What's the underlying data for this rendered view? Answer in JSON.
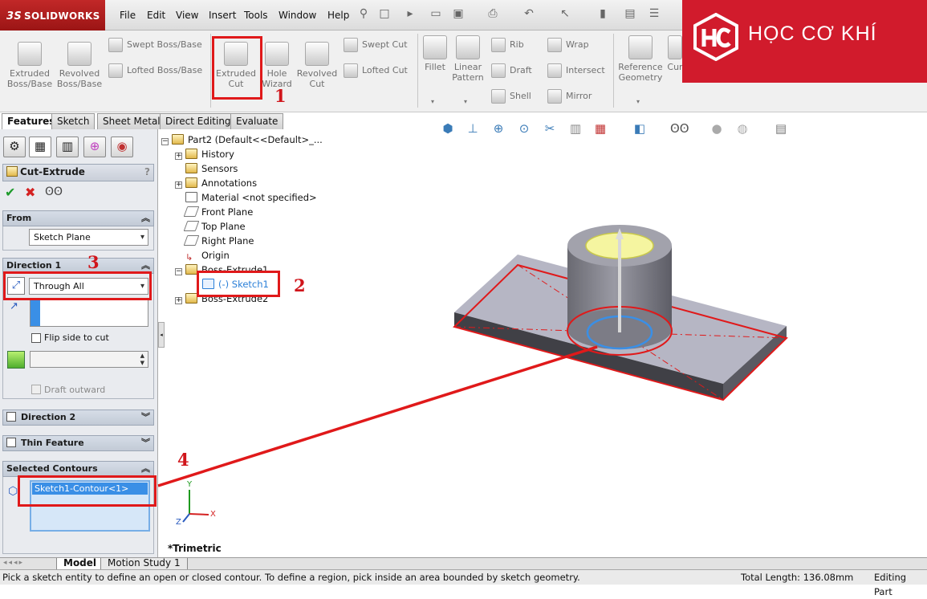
{
  "app": {
    "logo_text": "SOLIDWORKS",
    "logo_prefix": "3S"
  },
  "menu": [
    "File",
    "Edit",
    "View",
    "Insert",
    "Tools",
    "Window",
    "Help"
  ],
  "ribbon": {
    "extruded_boss": "Extruded\nBoss/Base",
    "revolved_boss": "Revolved\nBoss/Base",
    "swept_boss": "Swept Boss/Base",
    "lofted_boss": "Lofted Boss/Base",
    "extruded_cut": "Extruded\nCut",
    "hole_wizard": "Hole\nWizard",
    "revolved_cut": "Revolved\nCut",
    "swept_cut": "Swept Cut",
    "lofted_cut": "Lofted Cut",
    "fillet": "Fillet",
    "linear_pattern": "Linear\nPattern",
    "rib": "Rib",
    "draft": "Draft",
    "shell": "Shell",
    "wrap": "Wrap",
    "intersect": "Intersect",
    "mirror": "Mirror",
    "reference_geometry": "Reference\nGeometry",
    "curves": "Cur"
  },
  "brand": {
    "text": "HỌC CƠ KHÍ",
    "logo_letters": "HC",
    "color": "#d11b2c"
  },
  "tabs": [
    "Features",
    "Sketch",
    "Sheet Metal",
    "Direct Editing",
    "Evaluate"
  ],
  "property_manager": {
    "title": "Cut-Extrude",
    "help": "?",
    "from": {
      "header": "From",
      "value": "Sketch Plane"
    },
    "direction1": {
      "header": "Direction 1",
      "end_condition": "Through All",
      "flip_label": "Flip side to cut",
      "draft_label": "Draft outward"
    },
    "direction2": {
      "header": "Direction 2"
    },
    "thin_feature": {
      "header": "Thin Feature"
    },
    "selected_contours": {
      "header": "Selected Contours",
      "items": [
        "Sketch1-Contour<1>"
      ]
    }
  },
  "tree": {
    "root": "Part2  (Default<<Default>_...",
    "items": [
      "History",
      "Sensors",
      "Annotations",
      "Material <not specified>",
      "Front Plane",
      "Top Plane",
      "Right Plane",
      "Origin",
      "Boss-Extrude1",
      "(-) Sketch1",
      "Boss-Extrude2"
    ]
  },
  "viewport": {
    "view_label": "*Trimetric",
    "triad": {
      "x": "X",
      "y": "Y",
      "z": "Z"
    }
  },
  "annotations": {
    "n1": "1",
    "n2": "2",
    "n3": "3",
    "n4": "4",
    "color": "#e0191a"
  },
  "bottom_tabs": [
    "Model",
    "Motion Study 1"
  ],
  "status": {
    "message": "Pick a sketch entity to define an open or closed contour. To define a region, pick inside an area bounded by sketch geometry.",
    "total_length": "Total Length: 136.08mm",
    "mode": "Editing Part"
  }
}
